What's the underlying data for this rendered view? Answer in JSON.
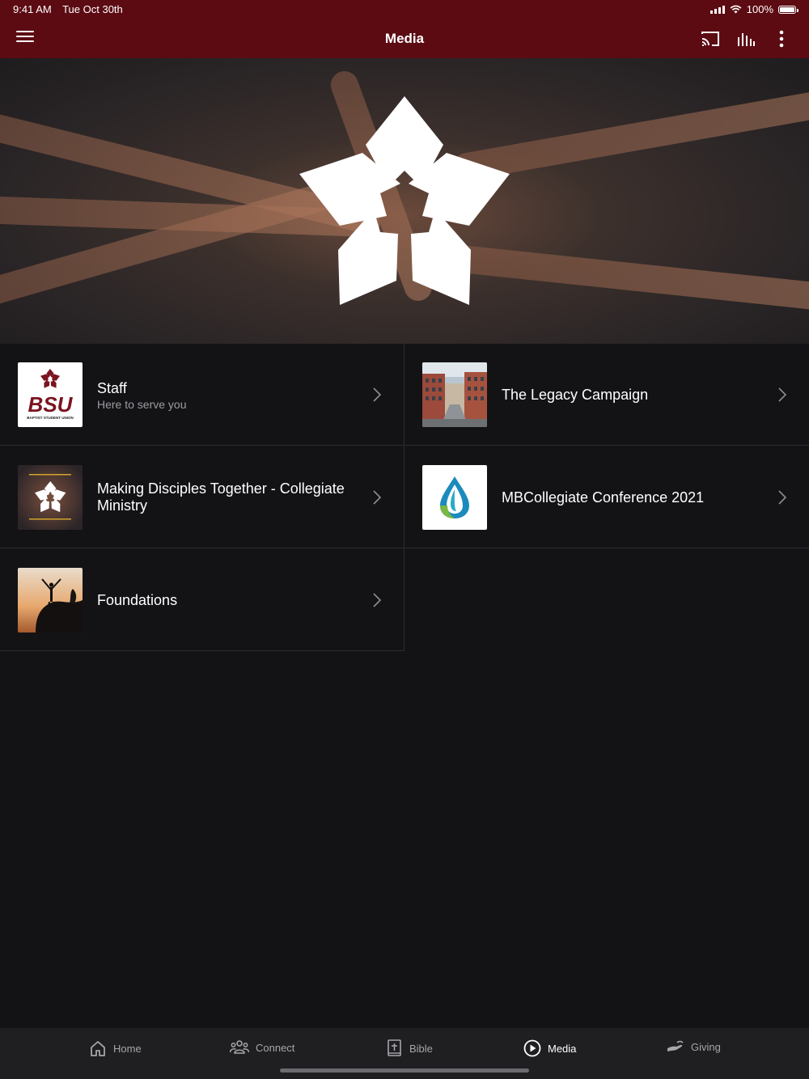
{
  "status": {
    "time": "9:41 AM",
    "date": "Tue Oct 30th",
    "battery": "100%",
    "battery_level": 1.0
  },
  "nav": {
    "title": "Media",
    "icons": [
      "menu-icon",
      "cast-icon",
      "audio-bars-icon",
      "more-vertical-icon"
    ]
  },
  "hero": {
    "icon": "bsu-star-logo"
  },
  "items": [
    {
      "title": "Staff",
      "subtitle": "Here to serve you",
      "thumb": "bsu-logo",
      "thumb_text": "BSU",
      "thumb_caption": "BAPTIST STUDENT UNION"
    },
    {
      "title": "The Legacy Campaign",
      "subtitle": "",
      "thumb": "street-buildings-photo"
    },
    {
      "title": "Making Disciples Together - Collegiate Ministry",
      "subtitle": "",
      "thumb": "star-logo-hands-photo"
    },
    {
      "title": "MBCollegiate Conference 2021",
      "subtitle": "",
      "thumb": "water-drop-logo"
    },
    {
      "title": "Foundations",
      "subtitle": "",
      "thumb": "silhouette-cliff-photo"
    }
  ],
  "tabs": [
    {
      "label": "Home",
      "icon": "home-icon"
    },
    {
      "label": "Connect",
      "icon": "people-icon"
    },
    {
      "label": "Bible",
      "icon": "bible-icon"
    },
    {
      "label": "Media",
      "icon": "play-circle-icon",
      "active": true
    },
    {
      "label": "Giving",
      "icon": "giving-hand-icon"
    }
  ],
  "colors": {
    "brand": "#5c0b13",
    "background": "#131316",
    "tabbar": "#1f1f22"
  }
}
